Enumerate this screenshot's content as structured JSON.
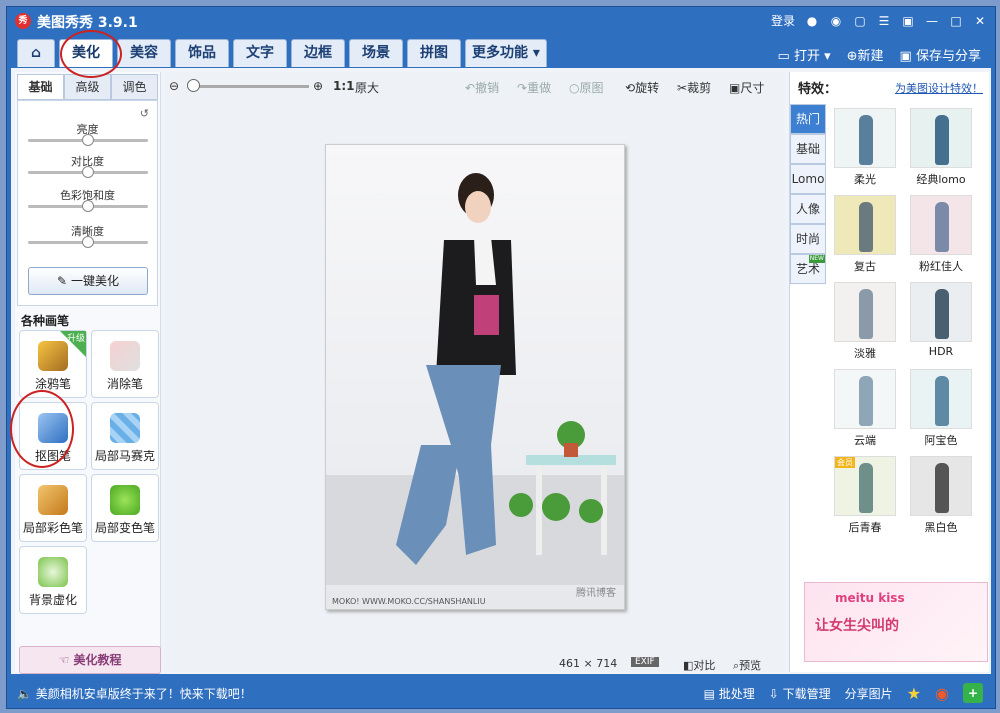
{
  "window": {
    "title": "美图秀秀 3.9.1"
  },
  "titlebar_right": [
    "登录"
  ],
  "tabs": [
    "美化",
    "美容",
    "饰品",
    "文字",
    "边框",
    "场景",
    "拼图",
    "更多功能"
  ],
  "top_actions": {
    "open": "打开",
    "new": "新建",
    "save": "保存与分享"
  },
  "left": {
    "subtabs": [
      "基础",
      "高级",
      "调色"
    ],
    "sliders": [
      "亮度",
      "对比度",
      "色彩饱和度",
      "清晰度"
    ],
    "onekey": "一键美化",
    "brushes_title": "各种画笔",
    "brushes": [
      "涂鸦笔",
      "消除笔",
      "抠图笔",
      "局部马赛克",
      "局部彩色笔",
      "局部变色笔",
      "背景虚化"
    ],
    "upgrade_tag": "升级",
    "tutorial": "美化教程"
  },
  "toolbar": {
    "ratio": "1:1",
    "original": "原大",
    "undo": "撤销",
    "redo": "重做",
    "origin": "原图",
    "rotate": "旋转",
    "crop": "裁剪",
    "size": "尺寸"
  },
  "photo": {
    "caption": "MOKO! WWW.MOKO.CC/SHANSHANLIU",
    "watermark": "腾讯博客"
  },
  "status": {
    "dims": "461 × 714",
    "exif": "EXIF",
    "compare": "对比",
    "preview": "预览"
  },
  "effects": {
    "title": "特效：",
    "link": "为美图设计特效！",
    "vtabs": [
      "热门",
      "基础",
      "Lomo",
      "人像",
      "时尚",
      "艺术"
    ],
    "new_badge": "NEW",
    "items": [
      "柔光",
      "经典lomo",
      "复古",
      "粉红佳人",
      "淡雅",
      "HDR",
      "云端",
      "阿宝色",
      "后青春",
      "黑白色"
    ],
    "member_tag": "会员",
    "ad_line1": "meitu kiss",
    "ad_line2": "让女生尖叫的"
  },
  "bottom": {
    "news": "美颜相机安卓版终于来了！快来下载吧！",
    "batch": "批处理",
    "download": "下载管理",
    "share": "分享图片"
  }
}
